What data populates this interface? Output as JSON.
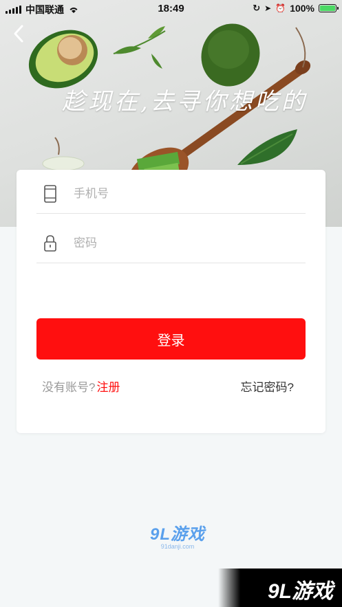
{
  "status_bar": {
    "carrier": "中国联通",
    "time": "18:49",
    "battery": "100%",
    "battery_level": 1.0
  },
  "hero": {
    "slogan": "趁现在,去寻你想吃的"
  },
  "form": {
    "phone_placeholder": "手机号",
    "password_placeholder": "密码",
    "login_label": "登录",
    "no_account_label": "没有账号?",
    "register_label": "注册",
    "forgot_label": "忘记密码?"
  },
  "watermark": {
    "logo_text": "9L游戏",
    "logo_url_text": "91danji.com",
    "corner_text": "9L游戏"
  },
  "colors": {
    "primary_red": "#ff0f0f",
    "background": "#f4f7f8",
    "battery_green": "#4cd964"
  }
}
